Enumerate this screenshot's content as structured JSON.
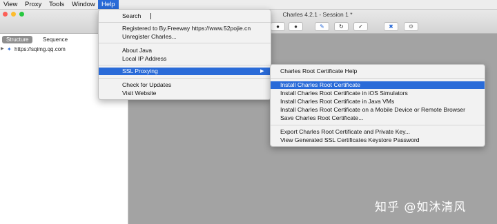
{
  "menubar": {
    "items": [
      "View",
      "Proxy",
      "Tools",
      "Window",
      "Help"
    ]
  },
  "window": {
    "title": "Charles 4.2.1 - Session 1 *"
  },
  "left_panel": {
    "tabs": [
      "Structure",
      "Sequence"
    ],
    "tree_item": "https://sqimg.qq.com"
  },
  "help_menu": {
    "search_label": "Search",
    "registered": "Registered to By.Freeway   https://www.52pojie.cn",
    "unregister": "Unregister Charles...",
    "about_java": "About Java",
    "local_ip": "Local IP Address",
    "ssl_proxying": "SSL Proxying",
    "check_updates": "Check for Updates",
    "visit_website": "Visit Website",
    "submenu_arrow": "▶"
  },
  "ssl_submenu": {
    "items": [
      "Charles Root Certificate Help",
      "Install Charles Root Certificate",
      "Install Charles Root Certificate in iOS Simulators",
      "Install Charles Root Certificate in Java VMs",
      "Install Charles Root Certificate on a Mobile Device or Remote Browser",
      "Save Charles Root Certificate...",
      "Export Charles Root Certificate and Private Key...",
      "View Generated SSL Certificates Keystore Password"
    ]
  },
  "watermark": "知乎 @如沐清风",
  "colors": {
    "highlight": "#2a6bd8",
    "menu_bg": "#f2f2f2",
    "canvas_bg": "#a3a3a3"
  }
}
